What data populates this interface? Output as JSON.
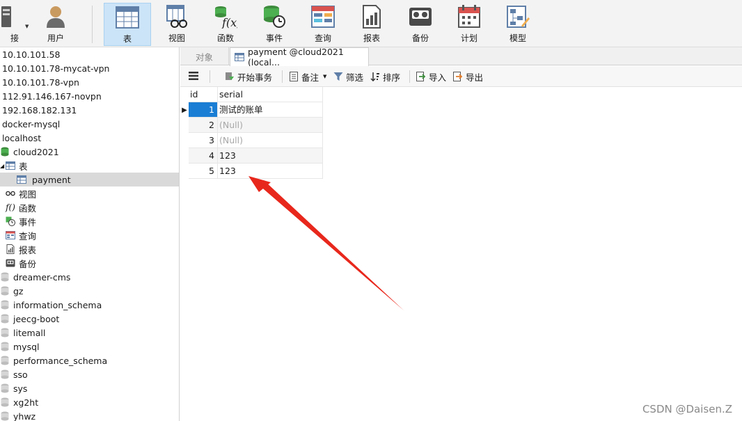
{
  "toolbar": {
    "items": [
      {
        "label": "接"
      },
      {
        "label": "用户"
      },
      {
        "label": "表"
      },
      {
        "label": "视图"
      },
      {
        "label": "函数"
      },
      {
        "label": "事件"
      },
      {
        "label": "查询"
      },
      {
        "label": "报表"
      },
      {
        "label": "备份"
      },
      {
        "label": "计划"
      },
      {
        "label": "模型"
      }
    ]
  },
  "navigator": {
    "items": [
      {
        "label": "10.10.101.58"
      },
      {
        "label": "10.10.101.78-mycat-vpn"
      },
      {
        "label": "10.10.101.78-vpn"
      },
      {
        "label": "112.91.146.167-novpn"
      },
      {
        "label": "192.168.182.131"
      },
      {
        "label": "docker-mysql"
      },
      {
        "label": "localhost"
      },
      {
        "label": "cloud2021"
      },
      {
        "label": "表"
      },
      {
        "label": "payment"
      },
      {
        "label": "视图"
      },
      {
        "label": "函数"
      },
      {
        "label": "事件"
      },
      {
        "label": "查询"
      },
      {
        "label": "报表"
      },
      {
        "label": "备份"
      },
      {
        "label": "dreamer-cms"
      },
      {
        "label": "gz"
      },
      {
        "label": "information_schema"
      },
      {
        "label": "jeecg-boot"
      },
      {
        "label": "litemall"
      },
      {
        "label": "mysql"
      },
      {
        "label": "performance_schema"
      },
      {
        "label": "sso"
      },
      {
        "label": "sys"
      },
      {
        "label": "xg2ht"
      },
      {
        "label": "yhwz"
      }
    ]
  },
  "tabs": {
    "objects": "对象",
    "payment": "payment @cloud2021 (local..."
  },
  "subtoolbar": {
    "begin_transaction": "开始事务",
    "memo": "备注",
    "filter": "筛选",
    "sort": "排序",
    "import": "导入",
    "export": "导出"
  },
  "grid": {
    "columns": [
      "id",
      "serial"
    ],
    "rows": [
      {
        "id": "1",
        "serial": "测试的账单"
      },
      {
        "id": "2",
        "serial": "(Null)"
      },
      {
        "id": "3",
        "serial": "(Null)"
      },
      {
        "id": "4",
        "serial": "123"
      },
      {
        "id": "5",
        "serial": "123"
      }
    ]
  },
  "watermark": "CSDN @Daisen.Z",
  "colors": {
    "selection": "#1a7ed4",
    "annotation_arrow": "#e8271c",
    "active_tool": "#cce4f7"
  }
}
